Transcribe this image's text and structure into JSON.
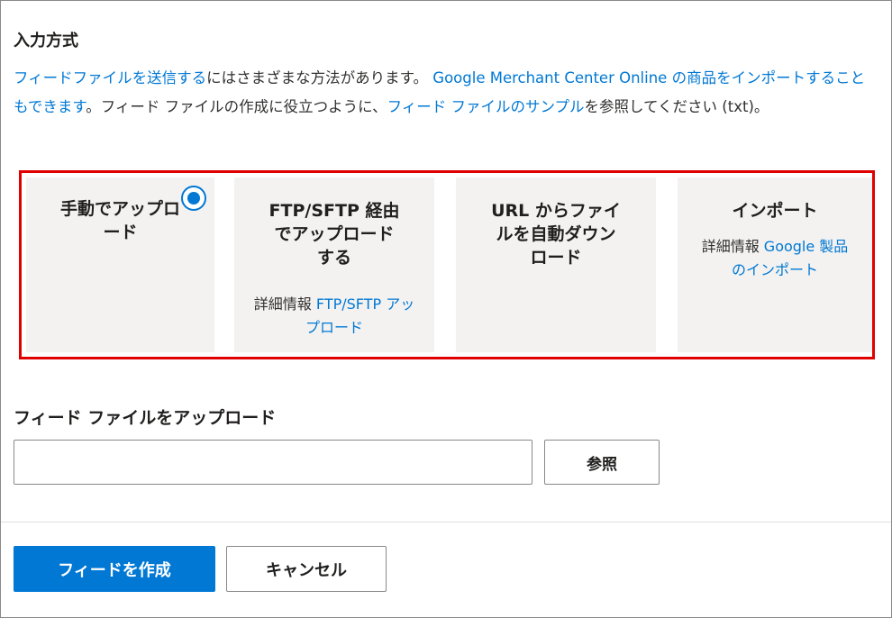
{
  "section": {
    "title": "入力方式"
  },
  "description": {
    "link_send_feed": "フィードファイルを送信する",
    "text_1": "にはさまざまな方法があります。 ",
    "link_import_products": "Google Merchant Center Online の商品をインポートすることもできます",
    "text_2": "。フィード ファイルの作成に役立つように、",
    "link_sample": "フィード ファイルのサンプル",
    "text_3": "を参照してください (txt)。"
  },
  "options": [
    {
      "title": "手動でアップロード",
      "selected": true
    },
    {
      "title": "FTP/SFTP 経由でアップロードする",
      "info_label": "詳細情報",
      "info_link": "FTP/SFTP アップロード"
    },
    {
      "title": "URL からファイルを自動ダウンロード"
    },
    {
      "title": "インポート",
      "info_label": "詳細情報",
      "info_link": "Google 製品のインポート"
    }
  ],
  "upload": {
    "label": "フィード ファイルをアップロード",
    "value": "",
    "browse_label": "参照"
  },
  "footer": {
    "create_label": "フィードを作成",
    "cancel_label": "キャンセル"
  },
  "colors": {
    "accent": "#0078d4",
    "highlight_border": "#e00000",
    "card_background": "#f3f2f1"
  }
}
